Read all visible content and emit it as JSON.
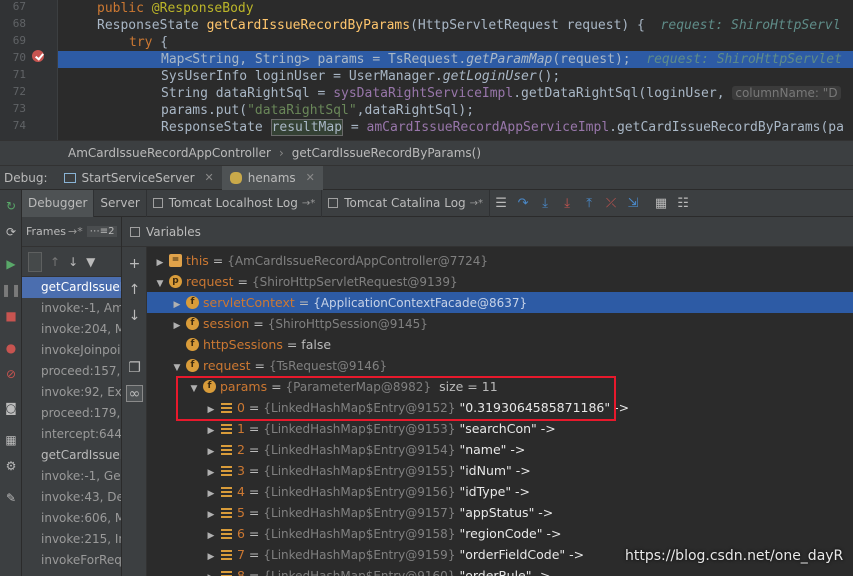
{
  "editor": {
    "line_numbers": [
      "67",
      "68",
      "69",
      "70",
      "71",
      "72",
      "73",
      "74"
    ],
    "lines": [
      {
        "text": "public @ResponseBody"
      },
      {
        "text": "ResponseState getCardIssueRecordByParams(HttpServletRequest request) {",
        "hint": "request: ShiroHttpServl"
      },
      {
        "text": "try {"
      },
      {
        "text": "Map<String, String> params = TsRequest.getParamMap(request);",
        "hint": "request: ShiroHttpServlet"
      },
      {
        "text": "SysUserInfo loginUser = UserManager.getLoginUser();"
      },
      {
        "text": "String dataRightSql = sysDataRightServiceImpl.getDataRightSql(loginUser,",
        "param_hint": "columnName: \"D"
      },
      {
        "text": "params.put(\"dataRightSql\",dataRightSql);"
      },
      {
        "text": "ResponseState resultMap = amCardIssueRecordAppServiceImpl.getCardIssueRecordByParams(pa"
      }
    ]
  },
  "breadcrumb": [
    "AmCardIssueRecordAppController",
    "getCardIssueRecordByParams()"
  ],
  "debug_tabs": {
    "label": "Debug:",
    "tabs": [
      {
        "label": "StartServiceServer",
        "icon": "server-icon"
      },
      {
        "label": "henams",
        "icon": "bug-icon"
      }
    ]
  },
  "sub_tabs": [
    {
      "label": "Debugger"
    },
    {
      "label": "Server"
    },
    {
      "label": "Tomcat Localhost Log",
      "pin": "→*"
    },
    {
      "label": "Tomcat Catalina Log",
      "pin": "→*"
    }
  ],
  "frames": {
    "title": "Frames",
    "title_suffix": "→*",
    "mini": "⋯≡2",
    "items": [
      {
        "label": "getCardIssueF",
        "selected": true
      },
      {
        "label": "invoke:-1, Am"
      },
      {
        "label": "invoke:204, M"
      },
      {
        "label": "invokeJoinpoi"
      },
      {
        "label": "proceed:157,"
      },
      {
        "label": "invoke:92, Exp"
      },
      {
        "label": "proceed:179,"
      },
      {
        "label": "intercept:644,"
      },
      {
        "label": "getCardIssueF",
        "white": true
      },
      {
        "label": "invoke:-1, Ger"
      },
      {
        "label": "invoke:43, Del"
      },
      {
        "label": "invoke:606, M"
      },
      {
        "label": "invoke:215, In"
      },
      {
        "label": "invokeForReq"
      }
    ]
  },
  "variables": {
    "title": "Variables",
    "rows": [
      {
        "indent": 0,
        "toggle": "right",
        "icon": "eq",
        "name": "this",
        "type": "{AmCardIssueRecordAppController@7724}"
      },
      {
        "indent": 0,
        "toggle": "down",
        "icon": "p",
        "name": "request",
        "type": "{ShiroHttpServletRequest@9139}"
      },
      {
        "indent": 1,
        "toggle": "right",
        "icon": "f",
        "name": "servletContext",
        "type": "{ApplicationContextFacade@8637}",
        "selected": true
      },
      {
        "indent": 1,
        "toggle": "right",
        "icon": "f",
        "name": "session",
        "type": "{ShiroHttpSession@9145}"
      },
      {
        "indent": 1,
        "toggle": "",
        "icon": "f",
        "name": "httpSessions",
        "value": "false"
      },
      {
        "indent": 1,
        "toggle": "down",
        "icon": "f",
        "name": "request",
        "type": "{TsRequest@9146}"
      },
      {
        "indent": 2,
        "toggle": "down",
        "icon": "f",
        "name": "params",
        "type": "{ParameterMap@8982}",
        "extra": "size = 11"
      },
      {
        "indent": 3,
        "toggle": "right",
        "icon": "lst",
        "name": "0",
        "type": "{LinkedHashMap$Entry@9152}",
        "str": "\"0.3193064585871186\" ->"
      },
      {
        "indent": 3,
        "toggle": "right",
        "icon": "lst",
        "name": "1",
        "type": "{LinkedHashMap$Entry@9153}",
        "str": "\"searchCon\" ->"
      },
      {
        "indent": 3,
        "toggle": "right",
        "icon": "lst",
        "name": "2",
        "type": "{LinkedHashMap$Entry@9154}",
        "str": "\"name\" ->"
      },
      {
        "indent": 3,
        "toggle": "right",
        "icon": "lst",
        "name": "3",
        "type": "{LinkedHashMap$Entry@9155}",
        "str": "\"idNum\" ->"
      },
      {
        "indent": 3,
        "toggle": "right",
        "icon": "lst",
        "name": "4",
        "type": "{LinkedHashMap$Entry@9156}",
        "str": "\"idType\" ->"
      },
      {
        "indent": 3,
        "toggle": "right",
        "icon": "lst",
        "name": "5",
        "type": "{LinkedHashMap$Entry@9157}",
        "str": "\"appStatus\" ->"
      },
      {
        "indent": 3,
        "toggle": "right",
        "icon": "lst",
        "name": "6",
        "type": "{LinkedHashMap$Entry@9158}",
        "str": "\"regionCode\" ->"
      },
      {
        "indent": 3,
        "toggle": "right",
        "icon": "lst",
        "name": "7",
        "type": "{LinkedHashMap$Entry@9159}",
        "str": "\"orderFieldCode\" ->"
      },
      {
        "indent": 3,
        "toggle": "right",
        "icon": "lst",
        "name": "8",
        "type": "{LinkedHashMap$Entry@9160}",
        "str": "\"orderRule\" ->"
      }
    ]
  },
  "watermark": "https://blog.csdn.net/one_dayR",
  "colors": {
    "background": "#2b2b2b",
    "panel": "#3c3f41",
    "selection": "#2d5ba5",
    "frame_selection": "#4b6eaf",
    "keyword": "#cc7832",
    "highlight_box": "#e8192c"
  }
}
